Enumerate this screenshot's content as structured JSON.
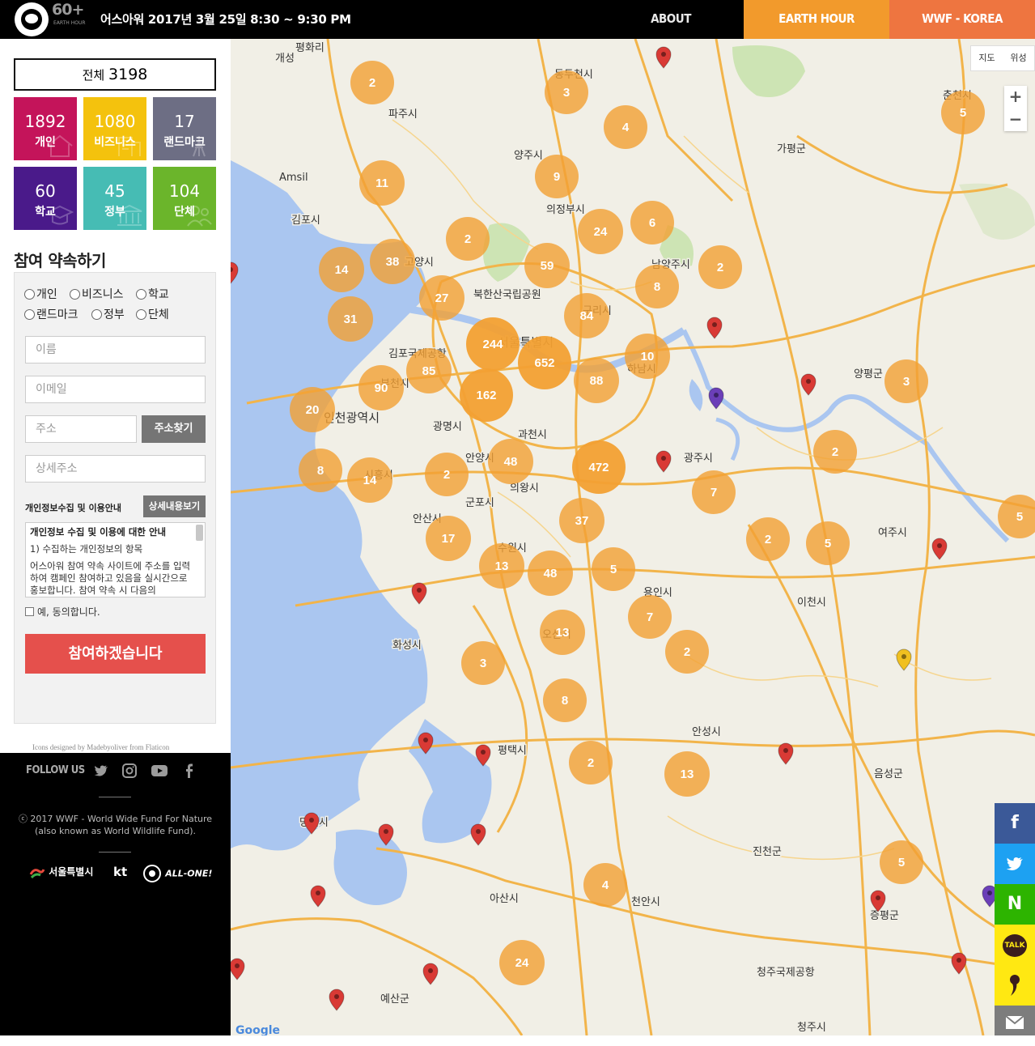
{
  "header": {
    "logo_mark": "60+",
    "logo_sub": "EARTH HOUR",
    "event_text": "어스아워 2017년 3월 25일 8:30 ~ 9:30 PM",
    "nav": [
      "ABOUT",
      "EARTH HOUR",
      "WWF - KOREA"
    ]
  },
  "totals": {
    "label": "전체",
    "value": "3198"
  },
  "categories": [
    {
      "count": "1892",
      "label": "개인",
      "color": "#c4145a"
    },
    {
      "count": "1080",
      "label": "비즈니스",
      "color": "#f4c20d"
    },
    {
      "count": "17",
      "label": "랜드마크",
      "color": "#6d6e84"
    },
    {
      "count": "60",
      "label": "학교",
      "color": "#4a1a8a"
    },
    {
      "count": "45",
      "label": "정부",
      "color": "#46bcb4"
    },
    {
      "count": "104",
      "label": "단체",
      "color": "#6bb52b"
    }
  ],
  "form": {
    "title": "참여 약속하기",
    "types": [
      "개인",
      "비즈니스",
      "학교",
      "랜드마크",
      "정부",
      "단체"
    ],
    "name_placeholder": "이름",
    "email_placeholder": "이메일",
    "address_placeholder": "주소",
    "find_address_label": "주소찾기",
    "detail_address_placeholder": "상세주소",
    "privacy_label": "개인정보수집 및 이용안내",
    "privacy_detail_button": "상세내용보기",
    "privacy_heading": "개인정보 수집 및 이용에 대한 안내",
    "privacy_item": "1) 수집하는 개인정보의 항목",
    "privacy_body": "어스아워 참여 약속 사이트에 주소를 입력하여 캠페인 참여하고 있음을 실시간으로 홍보합니다. 참여 약속 시 다음의",
    "agree_label": "예, 동의합니다.",
    "submit_label": "참여하겠습니다"
  },
  "credit": "Icons designed by Madebyoliver from Flaticon",
  "footer": {
    "follow_label": "FOLLOW US",
    "copyright_line1": "ⓒ 2017 WWF - World Wide Fund For Nature",
    "copyright_line2": "(also known as World Wildlife Fund).",
    "partners": [
      "서울특별시",
      "kt",
      "ALL-ONE!"
    ]
  },
  "map": {
    "type_options": [
      "지도",
      "위성"
    ],
    "zoom_in": "+",
    "zoom_out": "−",
    "attribution": "Google",
    "cities": [
      "개성",
      "파주시",
      "양주시",
      "동두천시",
      "의정부시",
      "가평군",
      "춘천시",
      "김포시",
      "고양시",
      "남양주시",
      "북한산국립공원",
      "서울특별시",
      "구리시",
      "하남시",
      "김포국제공항",
      "부천시",
      "인천광역시",
      "광명시",
      "과천시",
      "시흥시",
      "안양시",
      "의왕시",
      "광주시",
      "양평군",
      "군포시",
      "안산시",
      "수원시",
      "용인시",
      "여주시",
      "이천시",
      "화성시",
      "오산시",
      "평택시",
      "안성시",
      "음성군",
      "당진시",
      "진천군",
      "아산시",
      "천안시",
      "증평군",
      "예산군",
      "청주국제공항",
      "청주시",
      "Amsil",
      "평화리"
    ],
    "clusters": [
      "2",
      "3",
      "4",
      "5",
      "11",
      "9",
      "2",
      "24",
      "6",
      "14",
      "38",
      "59",
      "2",
      "8",
      "27",
      "31",
      "84",
      "244",
      "652",
      "10",
      "85",
      "90",
      "162",
      "88",
      "20",
      "3",
      "472",
      "48",
      "8",
      "14",
      "2",
      "2",
      "7",
      "37",
      "17",
      "5",
      "2",
      "5",
      "13",
      "48",
      "5",
      "13",
      "7",
      "2",
      "3",
      "8",
      "2",
      "13",
      "5",
      "4",
      "24"
    ]
  },
  "share": [
    "f",
    "twitter",
    "N",
    "TALK",
    "kakao-story",
    "mail"
  ],
  "colors": {
    "cluster": "#f2a033",
    "pin_red": "#d93a35",
    "pin_purple": "#6b3fb8",
    "pin_yellow": "#f0c020",
    "water": "#aac6f0",
    "road": "#f2b44a"
  }
}
